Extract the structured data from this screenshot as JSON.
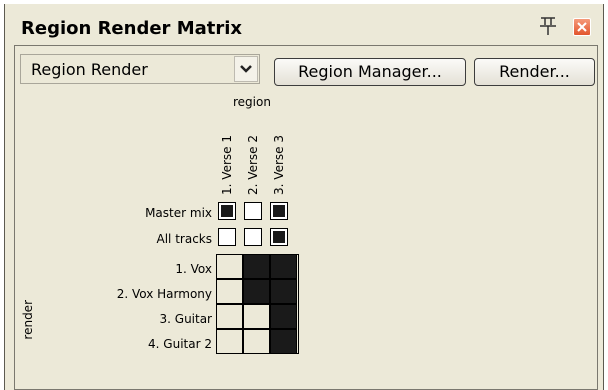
{
  "window": {
    "title": "Region Render Matrix"
  },
  "toolbar": {
    "dropdown_value": "Region Render",
    "region_manager_label": "Region Manager...",
    "render_label": "Render..."
  },
  "matrix": {
    "column_axis_label": "region",
    "row_axis_label": "render",
    "columns": [
      "1. Verse 1",
      "2. Verse 2",
      "3. Verse 3"
    ],
    "rows": [
      {
        "label": "Master mix",
        "cells": [
          true,
          false,
          true
        ]
      },
      {
        "label": "All tracks",
        "cells": [
          false,
          false,
          true
        ]
      },
      {
        "label": "1. Vox",
        "cells": [
          false,
          true,
          true
        ]
      },
      {
        "label": "2. Vox Harmony",
        "cells": [
          false,
          true,
          true
        ]
      },
      {
        "label": "3. Guitar",
        "cells": [
          false,
          false,
          true
        ]
      },
      {
        "label": "4. Guitar 2",
        "cells": [
          false,
          false,
          true
        ]
      }
    ]
  },
  "colors": {
    "background": "#ece9d8",
    "selected_cell": "#1a1a1a",
    "close_button": "#e2552d"
  },
  "icons": {
    "pin": "pin-icon",
    "close": "close-icon",
    "dropdown": "chevron-down-icon"
  }
}
